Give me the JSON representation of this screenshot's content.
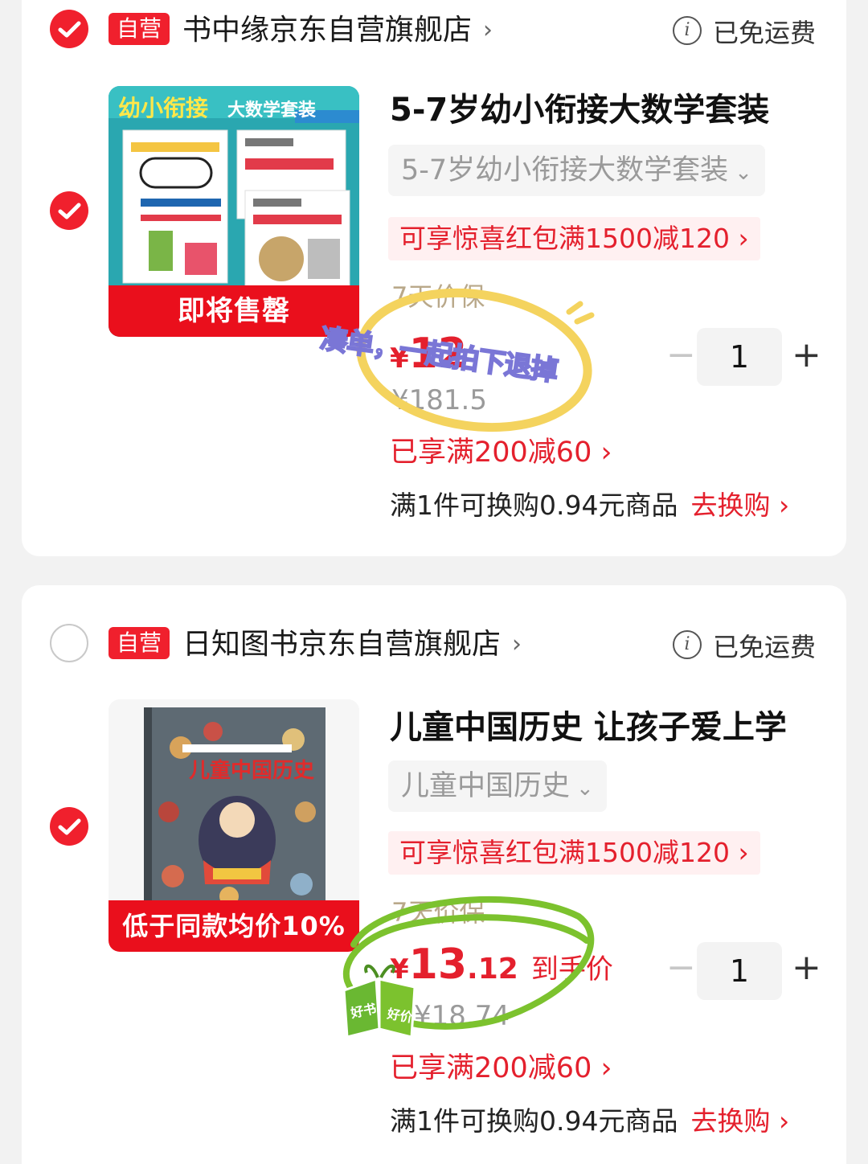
{
  "stores": [
    {
      "badge": "自营",
      "name": "书中缘京东自营旗舰店",
      "chevron": "›",
      "shipping_icon": "i",
      "shipping": "已免运费",
      "store_checked": true,
      "item": {
        "checked": true,
        "cover_title": "幼小衔接",
        "cover_subtitle": "大数学套装",
        "cover_label": "即将售罄",
        "title": "5-7岁幼小衔接大数学套装",
        "variant": "5-7岁幼小衔接大数学套装",
        "variant_chevron": "⌄",
        "promo": "可享惊喜红包满1500减120 ›",
        "guarantee": "7天价保",
        "price_currency": "¥",
        "price_int": "12",
        "price_tail": "",
        "original_price": "¥181.5",
        "discount": "已享满200减60 ›",
        "exchange": "满1件可换购0.94元商品",
        "exchange_link": "去换购 ›",
        "quantity": "1",
        "minus": "−",
        "plus": "+"
      }
    },
    {
      "badge": "自营",
      "name": "日知图书京东自营旗舰店",
      "chevron": "›",
      "shipping_icon": "i",
      "shipping": "已免运费",
      "store_checked": false,
      "item": {
        "checked": true,
        "cover_title": "儿童中国历史",
        "cover_label": "低于同款均价10%",
        "title": "儿童中国历史 让孩子爱上学",
        "variant": "儿童中国历史",
        "variant_chevron": "⌄",
        "promo": "可享惊喜红包满1500减120 ›",
        "guarantee": "7天价保",
        "price_currency": "¥",
        "price_int": "13",
        "price_dec": ".12",
        "price_tail": "到手价",
        "original_price": "¥18.74",
        "discount": "已享满200减60 ›",
        "exchange": "满1件可换购0.94元商品",
        "exchange_link": "去换购 ›",
        "quantity": "1",
        "minus": "−",
        "plus": "+"
      }
    }
  ],
  "annotations": {
    "sticker_text": "凑单，一起拍下退掉",
    "leaf_left": "好书",
    "leaf_right": "好价"
  },
  "colors": {
    "brand_red": "#f0202d",
    "promo_bg": "#fff0f1",
    "guarantee_gold": "#b9a88a",
    "circle_yellow": "#f4d35e",
    "circle_green": "#7cc22e"
  }
}
